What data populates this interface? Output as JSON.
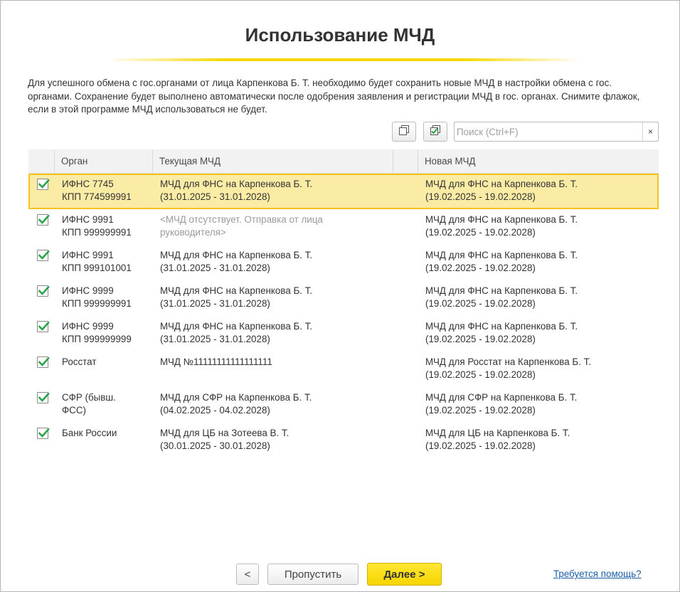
{
  "title": "Использование МЧД",
  "description": "Для успешного обмена с гос.органами от лица Карпенкова Б. Т. необходимо будет сохранить новые МЧД в настройки обмена с гос. органами. Сохранение будет выполнено автоматически после одобрения заявления и регистрации МЧД в гос. органах. Снимите флажок, если в этой программе МЧД использоваться не будет.",
  "toolbar": {
    "uncheck_all_icon": "uncheck-all-icon",
    "check_all_icon": "check-all-icon",
    "search_placeholder": "Поиск (Ctrl+F)",
    "search_value": "",
    "clear_label": "×"
  },
  "table": {
    "columns": {
      "organ": "Орган",
      "current": "Текущая МЧД",
      "new": "Новая МЧД"
    },
    "rows": [
      {
        "checked": true,
        "selected": true,
        "organ": [
          "ИФНС 7745",
          "КПП 774599991"
        ],
        "current": [
          "МЧД для ФНС на Карпенкова Б. Т.",
          "(31.01.2025 - 31.01.2028)"
        ],
        "current_missing": false,
        "new": [
          "МЧД для ФНС на Карпенкова Б. Т.",
          "(19.02.2025 - 19.02.2028)"
        ]
      },
      {
        "checked": true,
        "selected": false,
        "organ": [
          "ИФНС 9991",
          "КПП 999999991"
        ],
        "current": [
          "<МЧД отсутствует. Отправка от лица",
          "руководителя>"
        ],
        "current_missing": true,
        "new": [
          "МЧД для ФНС на Карпенкова Б. Т.",
          "(19.02.2025 - 19.02.2028)"
        ]
      },
      {
        "checked": true,
        "selected": false,
        "organ": [
          "ИФНС 9991",
          "КПП 999101001"
        ],
        "current": [
          "МЧД для ФНС на Карпенкова Б. Т.",
          "(31.01.2025 - 31.01.2028)"
        ],
        "current_missing": false,
        "new": [
          "МЧД для ФНС на Карпенкова Б. Т.",
          "(19.02.2025 - 19.02.2028)"
        ]
      },
      {
        "checked": true,
        "selected": false,
        "organ": [
          "ИФНС 9999",
          "КПП 999999991"
        ],
        "current": [
          "МЧД для ФНС на Карпенкова Б. Т.",
          "(31.01.2025 - 31.01.2028)"
        ],
        "current_missing": false,
        "new": [
          "МЧД для ФНС на Карпенкова Б. Т.",
          "(19.02.2025 - 19.02.2028)"
        ]
      },
      {
        "checked": true,
        "selected": false,
        "organ": [
          "ИФНС 9999",
          "КПП 999999999"
        ],
        "current": [
          "МЧД для ФНС на Карпенкова Б. Т.",
          "(31.01.2025 - 31.01.2028)"
        ],
        "current_missing": false,
        "new": [
          "МЧД для ФНС на Карпенкова Б. Т.",
          "(19.02.2025 - 19.02.2028)"
        ]
      },
      {
        "checked": true,
        "selected": false,
        "organ": [
          "Росстат",
          ""
        ],
        "current": [
          "МЧД №11111111111111111",
          ""
        ],
        "current_missing": false,
        "new": [
          "МЧД для Росстат на Карпенкова Б. Т.",
          "(19.02.2025 - 19.02.2028)"
        ]
      },
      {
        "checked": true,
        "selected": false,
        "organ": [
          "СФР (бывш.",
          "ФСС)"
        ],
        "current": [
          "МЧД для СФР на Карпенкова Б. Т.",
          "(04.02.2025 - 04.02.2028)"
        ],
        "current_missing": false,
        "new": [
          "МЧД для СФР на Карпенкова Б. Т.",
          "(19.02.2025 - 19.02.2028)"
        ]
      },
      {
        "checked": true,
        "selected": false,
        "organ": [
          "Банк России",
          ""
        ],
        "current": [
          "МЧД для ЦБ на Зотеева В. Т.",
          "(30.01.2025 - 30.01.2028)"
        ],
        "current_missing": false,
        "new": [
          "МЧД для ЦБ на Карпенкова Б. Т.",
          "(19.02.2025 - 19.02.2028)"
        ]
      }
    ]
  },
  "footer": {
    "back_label": "<",
    "skip_label": "Пропустить",
    "next_label": "Далее >",
    "help_label": "Требуется помощь?"
  },
  "colors": {
    "accent_yellow": "#f7d500",
    "selected_row_bg": "#fbeca5",
    "selected_row_border": "#f6c31d",
    "checkbox_green": "#2aa54a",
    "link_blue": "#1c5ea8"
  }
}
